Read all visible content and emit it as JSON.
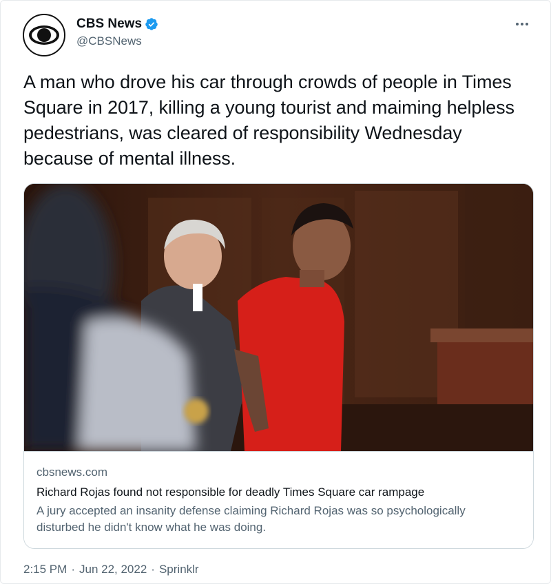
{
  "author": {
    "display_name": "CBS News",
    "handle": "@CBSNews",
    "verified": true,
    "avatar_icon": "cbs-eye-logo-icon",
    "verified_icon": "verified-badge-icon",
    "more_icon": "more-horizontal-icon",
    "accent_color": "#1d9bf0"
  },
  "tweet": {
    "text": "A man who drove his car through crowds of people in Times Square in 2017, killing a young tourist and maiming helpless pedestrians, was cleared of responsibility Wednesday because of mental illness."
  },
  "card": {
    "image_description_icon": "courtroom-photo",
    "domain": "cbsnews.com",
    "title": "Richard Rojas found not responsible for deadly Times Square car rampage",
    "description": "A jury accepted an insanity defense claiming Richard Rojas was so psychologically disturbed he didn't know what he was doing."
  },
  "meta": {
    "time": "2:15 PM",
    "separator": "·",
    "date": "Jun 22, 2022",
    "source": "Sprinklr"
  }
}
